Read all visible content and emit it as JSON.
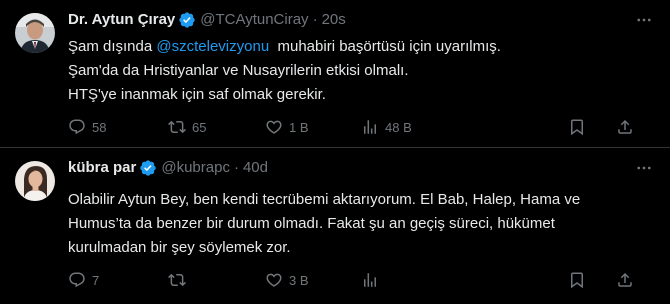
{
  "colors": {
    "background": "#000000",
    "text": "#e7e9ea",
    "muted": "#71767b",
    "accent": "#1d9bf0",
    "divider": "#2f3336"
  },
  "tweets": [
    {
      "author_name": "Dr. Aytun Çıray",
      "verified_icon": "verified-badge-icon",
      "handle": "@TCAytunCiray",
      "separator": "·",
      "time": "20s",
      "text": {
        "line1_before": "Şam dışında ",
        "line1_mention": "@szctelevizyonu",
        "line1_after": "  muhabiri başörtüsü için uyarılmış.",
        "line2": "Şam'da da Hristiyanlar ve Nusayrilerin etkisi olmalı.",
        "line3": "HTŞ'ye inanmak için saf olmak gerekir."
      },
      "actions": {
        "replies": "58",
        "retweets": "65",
        "likes": "1 B",
        "views": "48 B"
      }
    },
    {
      "author_name": "kübra par",
      "verified_icon": "verified-badge-icon",
      "handle": "@kubrapc",
      "separator": "·",
      "time": "40d",
      "text": {
        "line1": "Olabilir Aytun Bey, ben kendi tecrübemi aktarıyorum. El Bab, Halep, Hama ve",
        "line2": "Humus’ta da benzer bir durum olmadı. Fakat şu an geçiş süreci, hükümet",
        "line3": "kurulmadan bir şey söylemek zor."
      },
      "actions": {
        "replies": "7",
        "retweets": "",
        "likes": "3 B",
        "views": ""
      }
    }
  ]
}
